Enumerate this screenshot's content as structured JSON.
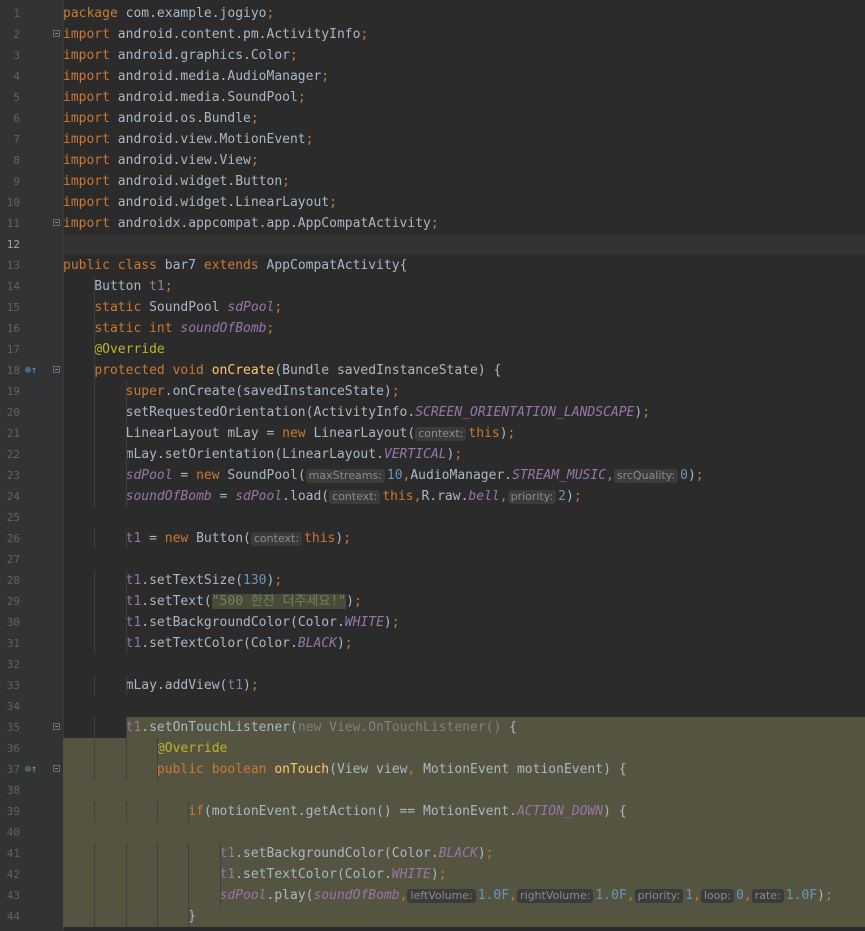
{
  "editor": {
    "language": "Java",
    "current_line": 12,
    "lines": [
      {
        "n": "1",
        "segs": [
          {
            "t": "package ",
            "c": "kw"
          },
          {
            "t": "com.example.jogiyo"
          },
          {
            "t": ";",
            "c": "kw"
          }
        ]
      },
      {
        "n": "2",
        "fold": true,
        "segs": [
          {
            "t": "import ",
            "c": "kw"
          },
          {
            "t": "android.content.pm.ActivityInfo"
          },
          {
            "t": ";",
            "c": "kw"
          }
        ]
      },
      {
        "n": "3",
        "segs": [
          {
            "t": "import ",
            "c": "kw"
          },
          {
            "t": "android.graphics.Color"
          },
          {
            "t": ";",
            "c": "kw"
          }
        ]
      },
      {
        "n": "4",
        "segs": [
          {
            "t": "import ",
            "c": "kw"
          },
          {
            "t": "android.media.AudioManager"
          },
          {
            "t": ";",
            "c": "kw"
          }
        ]
      },
      {
        "n": "5",
        "segs": [
          {
            "t": "import ",
            "c": "kw"
          },
          {
            "t": "android.media.SoundPool"
          },
          {
            "t": ";",
            "c": "kw"
          }
        ]
      },
      {
        "n": "6",
        "segs": [
          {
            "t": "import ",
            "c": "kw"
          },
          {
            "t": "android.os.Bundle"
          },
          {
            "t": ";",
            "c": "kw"
          }
        ]
      },
      {
        "n": "7",
        "segs": [
          {
            "t": "import ",
            "c": "kw"
          },
          {
            "t": "android.view.MotionEvent"
          },
          {
            "t": ";",
            "c": "kw"
          }
        ]
      },
      {
        "n": "8",
        "segs": [
          {
            "t": "import ",
            "c": "kw"
          },
          {
            "t": "android.view.View"
          },
          {
            "t": ";",
            "c": "kw"
          }
        ]
      },
      {
        "n": "9",
        "segs": [
          {
            "t": "import ",
            "c": "kw"
          },
          {
            "t": "android.widget.Button"
          },
          {
            "t": ";",
            "c": "kw"
          }
        ]
      },
      {
        "n": "10",
        "segs": [
          {
            "t": "import ",
            "c": "kw"
          },
          {
            "t": "android.widget.LinearLayout"
          },
          {
            "t": ";",
            "c": "kw"
          }
        ]
      },
      {
        "n": "11",
        "fold": true,
        "segs": [
          {
            "t": "import ",
            "c": "kw"
          },
          {
            "t": "androidx.appcompat.app.AppCompatActivity"
          },
          {
            "t": ";",
            "c": "kw"
          }
        ]
      },
      {
        "n": "12",
        "segs": []
      },
      {
        "n": "13",
        "segs": [
          {
            "t": "public class ",
            "c": "kw"
          },
          {
            "t": "bar7 "
          },
          {
            "t": "extends ",
            "c": "kw"
          },
          {
            "t": "AppCompatActivity{"
          }
        ]
      },
      {
        "n": "14",
        "segs": [
          {
            "t": "    Button "
          },
          {
            "t": "t1",
            "c": "ifld"
          },
          {
            "t": ";",
            "c": "kw"
          }
        ]
      },
      {
        "n": "15",
        "segs": [
          {
            "t": "    "
          },
          {
            "t": "static ",
            "c": "kw"
          },
          {
            "t": "SoundPool "
          },
          {
            "t": "sdPool",
            "c": "fld"
          },
          {
            "t": ";",
            "c": "kw"
          }
        ]
      },
      {
        "n": "16",
        "segs": [
          {
            "t": "    "
          },
          {
            "t": "static int ",
            "c": "kw"
          },
          {
            "t": "soundOfBomb",
            "c": "fld"
          },
          {
            "t": ";",
            "c": "kw"
          }
        ]
      },
      {
        "n": "17",
        "segs": [
          {
            "t": "    "
          },
          {
            "t": "@Override",
            "c": "ann"
          }
        ]
      },
      {
        "n": "18",
        "fold": true,
        "icon": "override",
        "segs": [
          {
            "t": "    "
          },
          {
            "t": "protected void ",
            "c": "kw"
          },
          {
            "t": "onCreate",
            "c": "fn"
          },
          {
            "t": "(Bundle savedInstanceState) {"
          }
        ]
      },
      {
        "n": "19",
        "segs": [
          {
            "t": "        "
          },
          {
            "t": "super",
            "c": "kw"
          },
          {
            "t": ".onCreate(savedInstanceState)"
          },
          {
            "t": ";",
            "c": "kw"
          }
        ]
      },
      {
        "n": "20",
        "segs": [
          {
            "t": "        setRequestedOrientation(ActivityInfo."
          },
          {
            "t": "SCREEN_ORIENTATION_LANDSCAPE",
            "c": "fld"
          },
          {
            "t": ")"
          },
          {
            "t": ";",
            "c": "kw"
          }
        ]
      },
      {
        "n": "21",
        "segs": [
          {
            "t": "        LinearLayout mLay = "
          },
          {
            "t": "new ",
            "c": "kw"
          },
          {
            "t": "LinearLayout("
          },
          {
            "t": "context:",
            "c": "hint"
          },
          {
            "t": "this",
            "c": "kw"
          },
          {
            "t": ")"
          },
          {
            "t": ";",
            "c": "kw"
          }
        ]
      },
      {
        "n": "22",
        "segs": [
          {
            "t": "        mLay.setOrientation(LinearLayout."
          },
          {
            "t": "VERTICAL",
            "c": "fld"
          },
          {
            "t": ")"
          },
          {
            "t": ";",
            "c": "kw"
          }
        ]
      },
      {
        "n": "23",
        "segs": [
          {
            "t": "        "
          },
          {
            "t": "sdPool",
            "c": "fld"
          },
          {
            "t": " = "
          },
          {
            "t": "new ",
            "c": "kw"
          },
          {
            "t": "SoundPool("
          },
          {
            "t": "maxStreams:",
            "c": "hint"
          },
          {
            "t": "10",
            "c": "num"
          },
          {
            "t": ",",
            "c": "kw"
          },
          {
            "t": "AudioManager."
          },
          {
            "t": "STREAM_MUSIC",
            "c": "fld"
          },
          {
            "t": ",",
            "c": "kw"
          },
          {
            "t": "srcQuality:",
            "c": "hint"
          },
          {
            "t": "0",
            "c": "num"
          },
          {
            "t": ")"
          },
          {
            "t": ";",
            "c": "kw"
          }
        ]
      },
      {
        "n": "24",
        "segs": [
          {
            "t": "        "
          },
          {
            "t": "soundOfBomb",
            "c": "fld"
          },
          {
            "t": " = "
          },
          {
            "t": "sdPool",
            "c": "fld"
          },
          {
            "t": ".load("
          },
          {
            "t": "context:",
            "c": "hint"
          },
          {
            "t": "this",
            "c": "kw"
          },
          {
            "t": ",",
            "c": "kw"
          },
          {
            "t": "R.raw."
          },
          {
            "t": "bell",
            "c": "fld"
          },
          {
            "t": ",",
            "c": "kw"
          },
          {
            "t": "priority:",
            "c": "hint"
          },
          {
            "t": "2",
            "c": "num"
          },
          {
            "t": ")"
          },
          {
            "t": ";",
            "c": "kw"
          }
        ]
      },
      {
        "n": "25",
        "segs": []
      },
      {
        "n": "26",
        "segs": [
          {
            "t": "        "
          },
          {
            "t": "t1",
            "c": "ifld"
          },
          {
            "t": " = "
          },
          {
            "t": "new ",
            "c": "kw"
          },
          {
            "t": "Button("
          },
          {
            "t": "context:",
            "c": "hint"
          },
          {
            "t": "this",
            "c": "kw"
          },
          {
            "t": ")"
          },
          {
            "t": ";",
            "c": "kw"
          }
        ]
      },
      {
        "n": "27",
        "segs": []
      },
      {
        "n": "28",
        "segs": [
          {
            "t": "        "
          },
          {
            "t": "t1",
            "c": "ifld"
          },
          {
            "t": ".setTextSize("
          },
          {
            "t": "130",
            "c": "num"
          },
          {
            "t": ")"
          },
          {
            "t": ";",
            "c": "kw"
          }
        ]
      },
      {
        "n": "29",
        "segs": [
          {
            "t": "        "
          },
          {
            "t": "t1",
            "c": "ifld"
          },
          {
            "t": ".setText("
          },
          {
            "t": "\"500 한잔 더주세요!\"",
            "c": "str strbox"
          },
          {
            "t": ")"
          },
          {
            "t": ";",
            "c": "kw"
          }
        ]
      },
      {
        "n": "30",
        "segs": [
          {
            "t": "        "
          },
          {
            "t": "t1",
            "c": "ifld"
          },
          {
            "t": ".setBackgroundColor(Color."
          },
          {
            "t": "WHITE",
            "c": "fld"
          },
          {
            "t": ")"
          },
          {
            "t": ";",
            "c": "kw"
          }
        ]
      },
      {
        "n": "31",
        "segs": [
          {
            "t": "        "
          },
          {
            "t": "t1",
            "c": "ifld"
          },
          {
            "t": ".setTextColor(Color."
          },
          {
            "t": "BLACK",
            "c": "fld"
          },
          {
            "t": ")"
          },
          {
            "t": ";",
            "c": "kw"
          }
        ]
      },
      {
        "n": "32",
        "segs": []
      },
      {
        "n": "33",
        "segs": [
          {
            "t": "        mLay.addView("
          },
          {
            "t": "t1",
            "c": "ifld"
          },
          {
            "t": ")"
          },
          {
            "t": ";",
            "c": "kw"
          }
        ]
      },
      {
        "n": "34",
        "segs": []
      },
      {
        "n": "35",
        "fold": true,
        "hlfrom": 64,
        "segs": [
          {
            "t": "        "
          },
          {
            "t": "t1",
            "c": "ifld"
          },
          {
            "t": ".setOnTouchListener("
          },
          {
            "t": "new View.OnTouchListener()",
            "c": "grey"
          },
          {
            "t": " {"
          }
        ]
      },
      {
        "n": "36",
        "hl": true,
        "segs": [
          {
            "t": "            "
          },
          {
            "t": "@Override",
            "c": "ann"
          }
        ]
      },
      {
        "n": "37",
        "hl": true,
        "fold": true,
        "icon": "impl",
        "segs": [
          {
            "t": "            "
          },
          {
            "t": "public boolean ",
            "c": "kw"
          },
          {
            "t": "onTouch",
            "c": "fn"
          },
          {
            "t": "(View view"
          },
          {
            "t": ", ",
            "c": "kw"
          },
          {
            "t": "MotionEvent motionEvent) {"
          }
        ]
      },
      {
        "n": "38",
        "hl": true,
        "segs": []
      },
      {
        "n": "39",
        "hl": true,
        "segs": [
          {
            "t": "                "
          },
          {
            "t": "if",
            "c": "kw"
          },
          {
            "t": "(motionEvent.getAction() == MotionEvent."
          },
          {
            "t": "ACTION_DOWN",
            "c": "fld"
          },
          {
            "t": ") {"
          }
        ]
      },
      {
        "n": "40",
        "hl": true,
        "segs": []
      },
      {
        "n": "41",
        "hl": true,
        "segs": [
          {
            "t": "                    "
          },
          {
            "t": "t1",
            "c": "ifld"
          },
          {
            "t": ".setBackgroundColor(Color."
          },
          {
            "t": "BLACK",
            "c": "fld"
          },
          {
            "t": ")"
          },
          {
            "t": ";",
            "c": "kw"
          }
        ]
      },
      {
        "n": "42",
        "hl": true,
        "segs": [
          {
            "t": "                    "
          },
          {
            "t": "t1",
            "c": "ifld"
          },
          {
            "t": ".setTextColor(Color."
          },
          {
            "t": "WHITE",
            "c": "fld"
          },
          {
            "t": ")"
          },
          {
            "t": ";",
            "c": "kw"
          }
        ]
      },
      {
        "n": "43",
        "hl": true,
        "segs": [
          {
            "t": "                    "
          },
          {
            "t": "sdPool",
            "c": "fld"
          },
          {
            "t": ".play("
          },
          {
            "t": "soundOfBomb",
            "c": "fld"
          },
          {
            "t": ",",
            "c": "kw"
          },
          {
            "t": "leftVolume:",
            "c": "hint"
          },
          {
            "t": "1.0F",
            "c": "num"
          },
          {
            "t": ",",
            "c": "kw"
          },
          {
            "t": "rightVolume:",
            "c": "hint"
          },
          {
            "t": "1.0F",
            "c": "num"
          },
          {
            "t": ",",
            "c": "kw"
          },
          {
            "t": "priority:",
            "c": "hint"
          },
          {
            "t": "1",
            "c": "num"
          },
          {
            "t": ",",
            "c": "kw"
          },
          {
            "t": "loop:",
            "c": "hint"
          },
          {
            "t": "0",
            "c": "num"
          },
          {
            "t": ",",
            "c": "kw"
          },
          {
            "t": "rate:",
            "c": "hint"
          },
          {
            "t": "1.0F",
            "c": "num"
          },
          {
            "t": ")"
          },
          {
            "t": ";",
            "c": "kw"
          }
        ]
      },
      {
        "n": "44",
        "hl": true,
        "segs": [
          {
            "t": "                }"
          }
        ]
      }
    ]
  },
  "colors": {
    "background": "#2b2b2b",
    "gutter": "#313335",
    "keyword": "#cc7832",
    "method": "#ffc66d",
    "number": "#6897bb",
    "string": "#6a8759",
    "field": "#9876aa",
    "annotation": "#bbb529",
    "highlight": "#555440"
  }
}
